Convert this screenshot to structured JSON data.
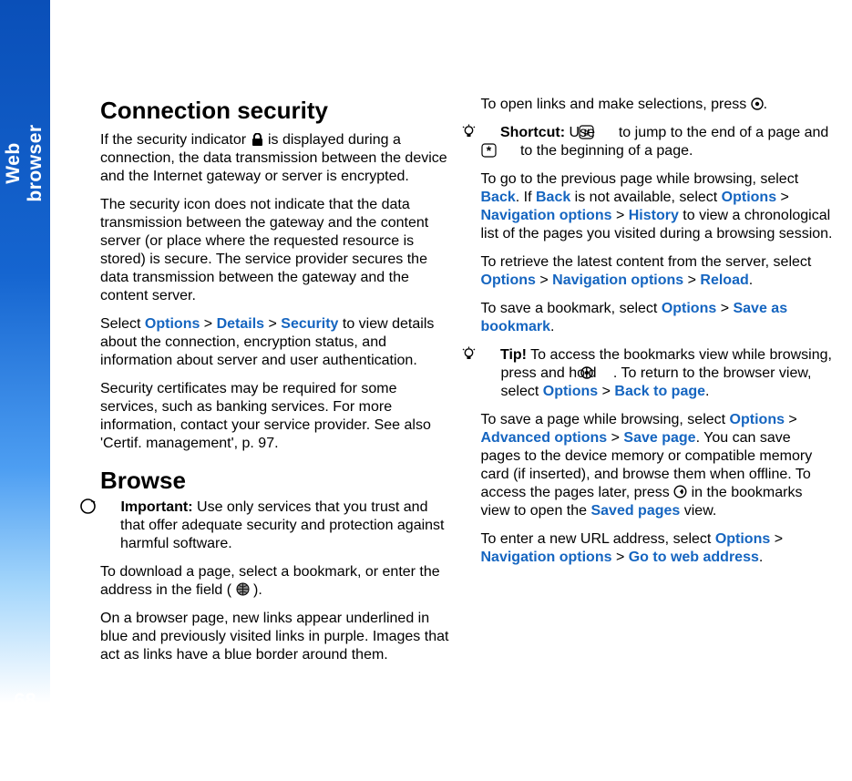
{
  "sidebar": {
    "label": "Web browser",
    "page": "68"
  },
  "h1": "Connection security",
  "h2": "Browse",
  "links": {
    "options": "Options",
    "details": "Details",
    "security": "Security",
    "back": "Back",
    "navopts": "Navigation options",
    "history": "History",
    "reload": "Reload",
    "savebm": "Save as bookmark",
    "backpage": "Back to page",
    "advopts": "Advanced options",
    "savepage": "Save page",
    "savedpages": "Saved pages",
    "gotoweb": "Go to web address"
  },
  "labels": {
    "shortcut": "Shortcut:",
    "tip": "Tip!",
    "important": "Important:"
  },
  "p": {
    "c1a": "If the security indicator ",
    "c1b": " is displayed during a connection, the data transmission between the device and the Internet gateway or server is encrypted.",
    "c2": "The security icon does not indicate that the data transmission between the gateway and the content server (or place where the requested resource is stored) is secure. The service provider secures the data transmission between the gateway and the content server.",
    "c3a": "Select ",
    "c3b": " to view details about the connection, encryption status, and information about server and user authentication.",
    "c4": "Security certificates may be required for some services, such as banking services. For more information, contact your service provider. See also 'Certif. management', p. 97.",
    "b1": " Use only services that you trust and that offer adequate security and protection against harmful software.",
    "b2a": "To download a page, select a bookmark, or enter the address in the field (",
    "b2b": ").",
    "r1": "On a browser page, new links appear underlined in blue and previously visited links in purple. Images that act as links have a blue border around them.",
    "r2a": "To open links and make selections, press ",
    "r2b": ".",
    "r3a": " Use ",
    "r3b": " to jump to the end of a page and ",
    "r3c": " to the beginning of a page.",
    "r4a": "To go to the previous page while browsing, select ",
    "r4b": ". If ",
    "r4c": " is not available, select ",
    "r4d": " to view a chronological list of the pages you visited during a browsing session.",
    "r5a": "To retrieve the latest content from the server, select ",
    "r5b": ".",
    "r6a": "To save a bookmark, select ",
    "r6b": ".",
    "r7a": " To access the bookmarks view while browsing, press and hold ",
    "r7b": ". To return to the browser view, select ",
    "r7c": ".",
    "r8a": "To save a page while browsing, select ",
    "r8b": ". You can save pages to the device memory or compatible memory card (if inserted), and browse them when offline. To access the pages later, press ",
    "r8c": " in the bookmarks view to open the ",
    "r8d": " view.",
    "r9a": "To enter a new URL address, select ",
    "r9b": "."
  },
  "sep": " > "
}
